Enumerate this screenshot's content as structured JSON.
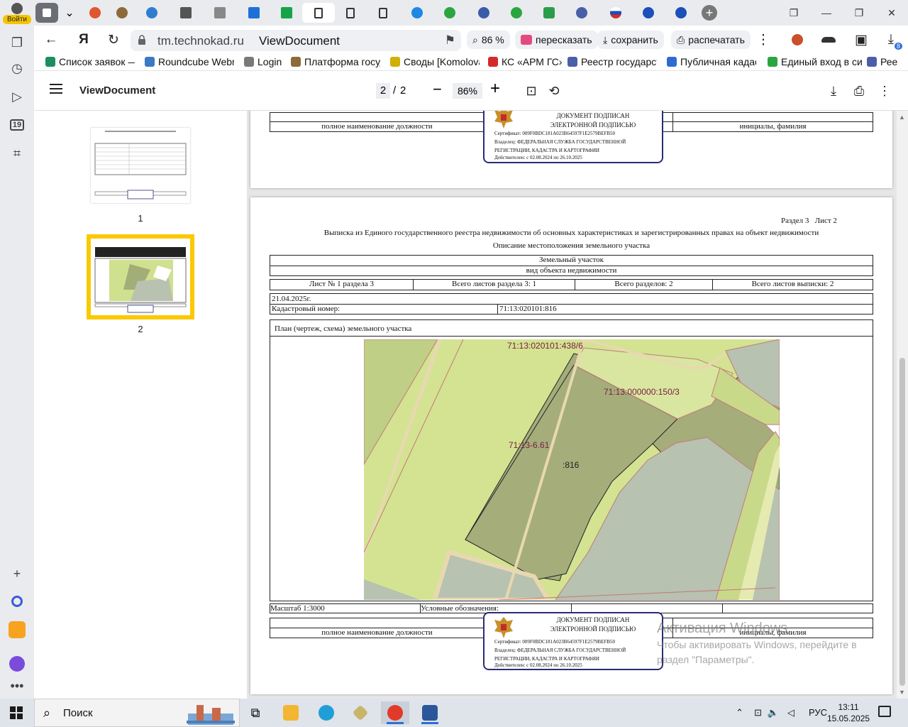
{
  "browser": {
    "profile_label": "Войти",
    "omnibox": {
      "domain": "tm.technokad.ru",
      "title": "ViewDocument"
    },
    "zoom_badge": "86 %",
    "retell_label": "пересказать",
    "save_label": "сохранить",
    "print_label": "распечатать",
    "downloads_count": "8",
    "bookmarks": [
      {
        "label": "Список заявок —",
        "color": "#1d8f5f"
      },
      {
        "label": "Roundcube Webm",
        "color": "#3a79c4"
      },
      {
        "label": "Login",
        "color": "#7a7a7a"
      },
      {
        "label": "Платформа госуд",
        "color": "#8d6a3a"
      },
      {
        "label": "Своды [Komolova",
        "color": "#d0b000"
      },
      {
        "label": "КС «АРМ ГС»",
        "color": "#d52a2a"
      },
      {
        "label": "Реестр государст",
        "color": "#4a5fa8"
      },
      {
        "label": "Публичная кадаст",
        "color": "#2e6bd0"
      },
      {
        "label": "Единый вход в си",
        "color": "#2aa640"
      },
      {
        "label": "Рее",
        "color": "#4a5fa8"
      }
    ],
    "rail_calendar_day": "19"
  },
  "pdf_viewer": {
    "title": "ViewDocument",
    "current_page": "2",
    "page_separator": "/",
    "total_pages": "2",
    "zoom": "86%",
    "thumbnails": [
      {
        "number": "1"
      },
      {
        "number": "2"
      }
    ]
  },
  "document": {
    "page1": {
      "position_label": "полное наименование должности",
      "name_label": "инициалы, фамилия"
    },
    "page2": {
      "section": "Раздел 3",
      "sheet": "Лист 2",
      "heading": "Выписка из Единого государственного реестра недвижимости об основных характеристиках и зарегистрированных правах на объект недвижимости",
      "subheading": "Описание местоположения земельного участка",
      "object_type": "Земельный участок",
      "object_type_caption": "вид объекта недвижимости",
      "sheet_info": [
        "Лист № 1 раздела 3",
        "Всего листов раздела 3: 1",
        "Всего разделов: 2",
        "Всего листов выписки: 2"
      ],
      "date": "21.04.2025г.",
      "cadastral_label": "Кадастровый номер:",
      "cadastral_number": "71:13:020101:816",
      "plan_title": "План (чертеж, схема) земельного участка",
      "map_labels": [
        "71:13:020101:438/6",
        "71:13:000000:150/3",
        "71:13-6.61",
        ":816"
      ],
      "scale": "Масштаб 1:3000",
      "legend_label": "Условные обозначения:",
      "position_label": "полное наименование должности",
      "name_label": "инициалы, фамилия"
    },
    "signature_stamp": {
      "line1": "ДОКУМЕНТ ПОДПИСАН",
      "line2": "ЭЛЕКТРОННОЙ ПОДПИСЬЮ",
      "certificate": "Сертификат: 009F0BDC181A023B64597F1E2579BEFB50",
      "owner1": "Владелец: ФЕДЕРАЛЬНАЯ СЛУЖБА ГОСУДАРСТВЕННОЙ",
      "owner2": "РЕГИСТРАЦИИ, КАДАСТРА И КАРТОГРАФИИ",
      "valid": "Действителен: с 02.08.2024 по 26.10.2025"
    }
  },
  "watermark": {
    "title": "Активация Windows",
    "line1": "Чтобы активировать Windows, перейдите в",
    "line2": "раздел \"Параметры\"."
  },
  "taskbar": {
    "search_placeholder": "Поиск",
    "language": "РУС",
    "time": "13:11",
    "date": "15.05.2025"
  }
}
